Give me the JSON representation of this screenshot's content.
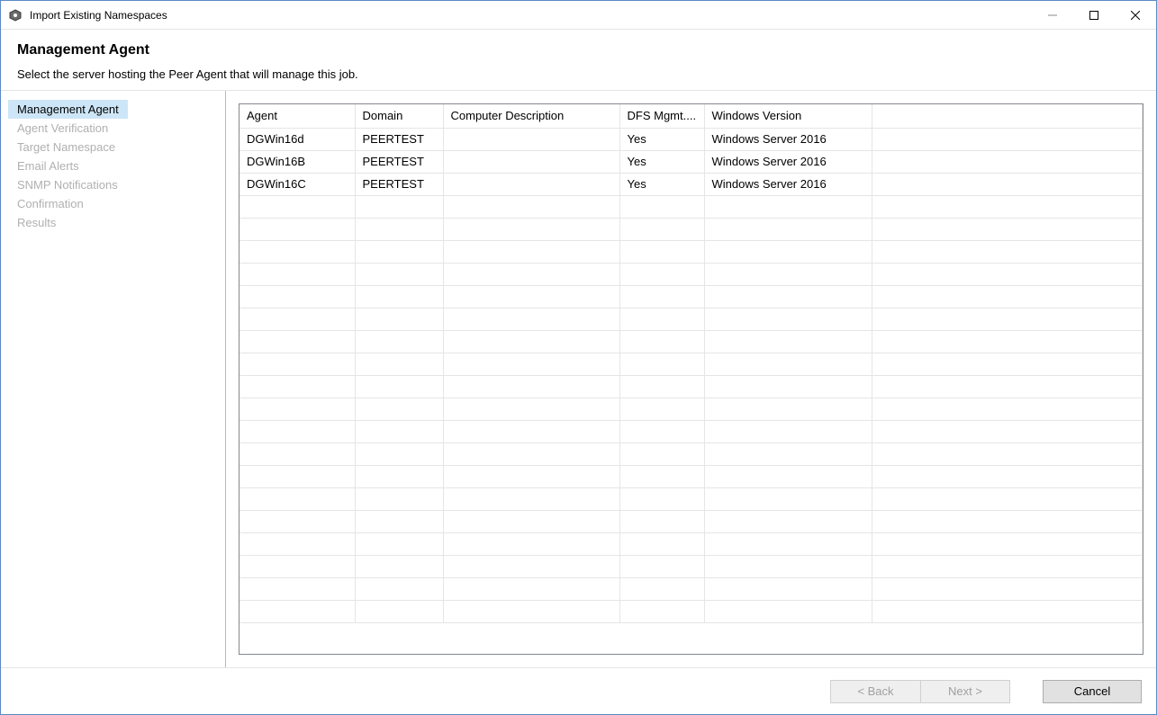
{
  "window": {
    "title": "Import Existing Namespaces"
  },
  "header": {
    "title": "Management Agent",
    "subtitle": "Select the server hosting the Peer Agent that will manage this job."
  },
  "sidebar": {
    "items": [
      {
        "label": "Management Agent",
        "active": true
      },
      {
        "label": "Agent Verification",
        "active": false
      },
      {
        "label": "Target Namespace",
        "active": false
      },
      {
        "label": "Email Alerts",
        "active": false
      },
      {
        "label": "SNMP Notifications",
        "active": false
      },
      {
        "label": "Confirmation",
        "active": false
      },
      {
        "label": "Results",
        "active": false
      }
    ]
  },
  "table": {
    "columns": [
      "Agent",
      "Domain",
      "Computer Description",
      "DFS Mgmt....",
      "Windows Version",
      ""
    ],
    "rows": [
      {
        "agent": "DGWin16d",
        "domain": "PEERTEST",
        "desc": "",
        "dfs": "Yes",
        "winver": "Windows Server 2016",
        "extra": ""
      },
      {
        "agent": "DGWin16B",
        "domain": "PEERTEST",
        "desc": "",
        "dfs": "Yes",
        "winver": "Windows Server 2016",
        "extra": ""
      },
      {
        "agent": "DGWin16C",
        "domain": "PEERTEST",
        "desc": "",
        "dfs": "Yes",
        "winver": "Windows Server 2016",
        "extra": ""
      }
    ],
    "empty_row_count": 19
  },
  "footer": {
    "back_label": "< Back",
    "next_label": "Next >",
    "cancel_label": "Cancel"
  }
}
